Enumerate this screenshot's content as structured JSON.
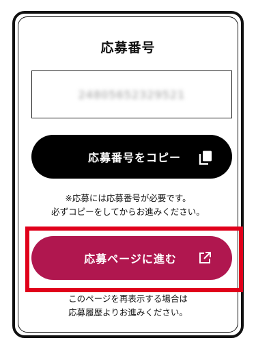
{
  "card": {
    "title": "応募番号",
    "code_value": "24805652329521",
    "copy_button_label": "応募番号をコピー",
    "copy_icon": "copy-icon",
    "note_line1": "※応募には応募番号が必要です。",
    "note_line2": "必ずコピーをしてからお進みください。",
    "proceed_button_label": "応募ページに進む",
    "external_icon": "external-link-icon",
    "footer_line1": "このページを再表示する場合は",
    "footer_line2": "応募履歴よりお進みください。"
  },
  "colors": {
    "primary_dark": "#000000",
    "accent_magenta": "#b0174f",
    "highlight_red": "#e0001a"
  }
}
